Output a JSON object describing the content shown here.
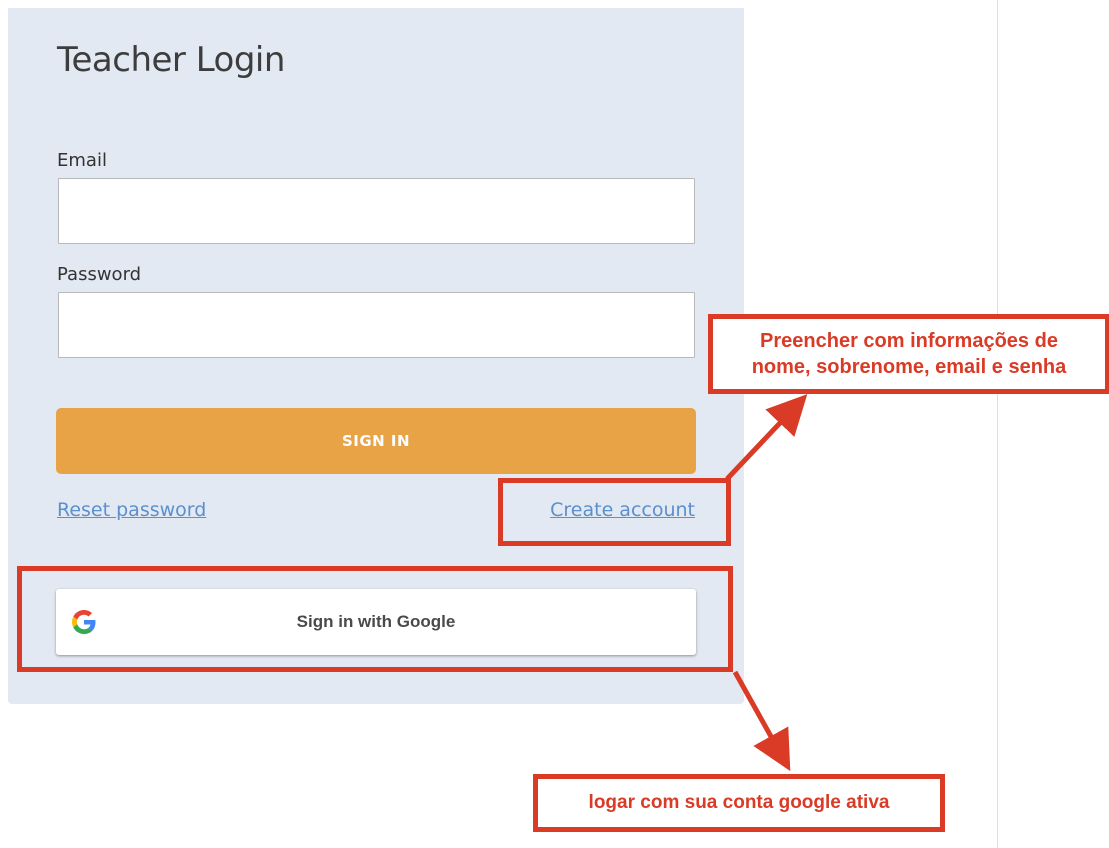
{
  "login": {
    "title": "Teacher Login",
    "email_label": "Email",
    "email_value": "",
    "password_label": "Password",
    "password_value": "",
    "signin_label": "SIGN IN",
    "reset_link": "Reset password",
    "create_link": "Create account",
    "google_label": "Sign in with Google"
  },
  "annotations": {
    "create_note_line1": "Preencher com informações de",
    "create_note_line2": "nome, sobrenome, email e senha",
    "google_note": "logar com sua conta google ativa"
  },
  "colors": {
    "panel_bg": "#e2e9f2",
    "signin_button": "#e8a347",
    "link": "#5b8fcd",
    "annotation_red": "#d93b26"
  },
  "icons": {
    "google_logo": "google-g-icon"
  }
}
